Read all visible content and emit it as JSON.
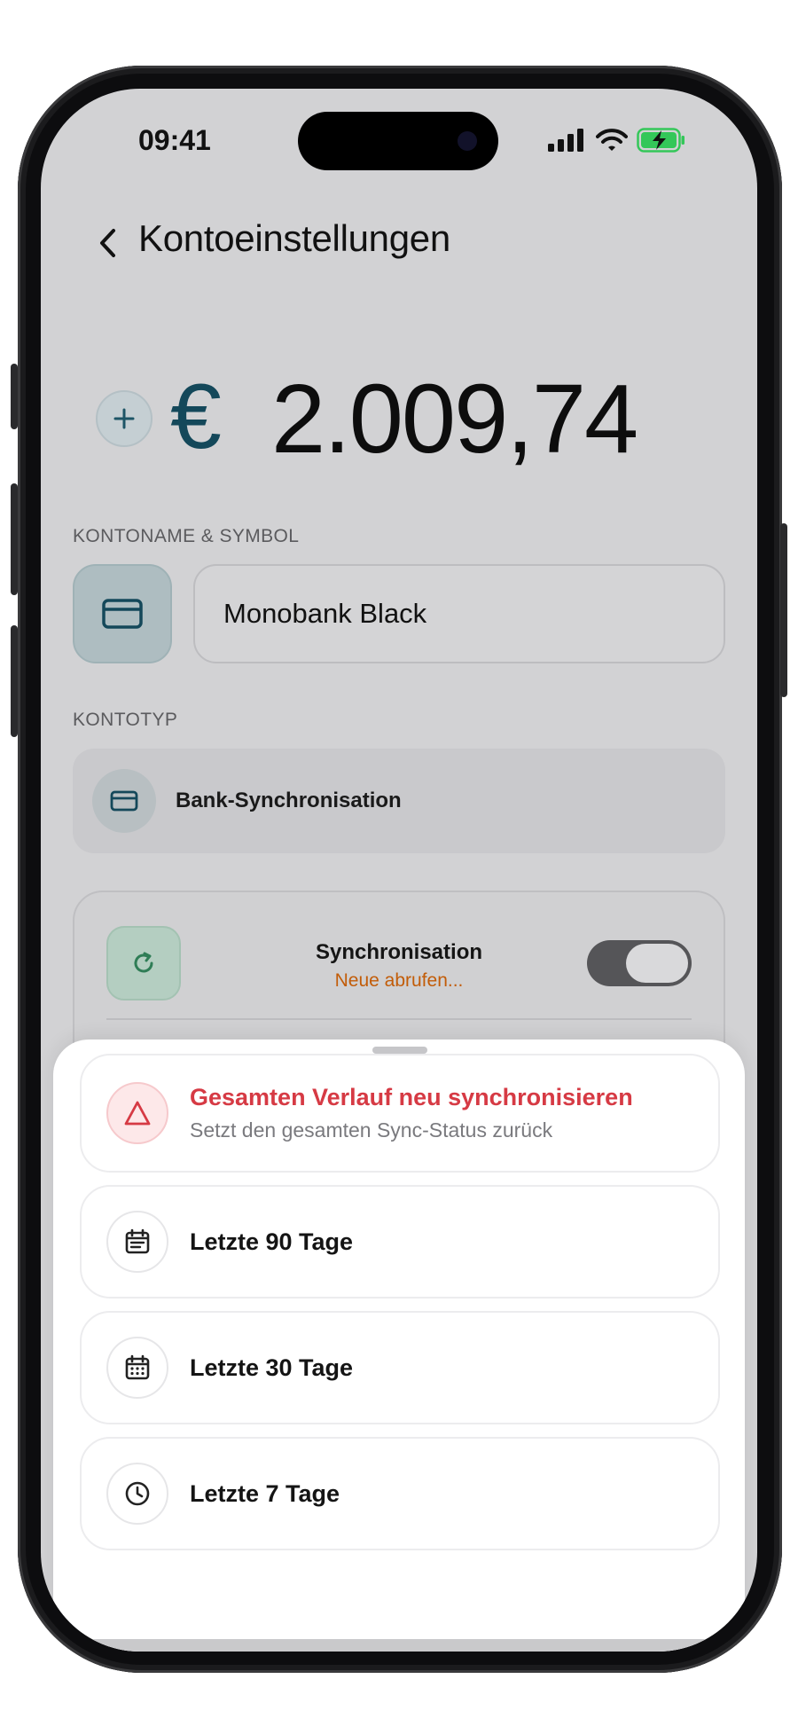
{
  "status_bar": {
    "time": "09:41"
  },
  "header": {
    "back_icon": "chevron-left-icon",
    "title": "Kontoeinstellungen"
  },
  "balance": {
    "add_icon": "plus-icon",
    "currency_symbol": "€",
    "amount": "2.009,74"
  },
  "account_name": {
    "section_label": "KONTONAME & SYMBOL",
    "symbol_icon": "credit-card-icon",
    "value": "Monobank Black"
  },
  "account_type": {
    "section_label": "KONTOTYP",
    "icon": "credit-card-icon",
    "label": "Bank-Synchronisation"
  },
  "sync": {
    "icon": "refresh-icon",
    "title": "Synchronisation",
    "status": "Neue abrufen...",
    "toggle_on": true
  },
  "sheet": {
    "options": [
      {
        "icon": "warning-triangle-icon",
        "title": "Gesamten Verlauf neu synchronisieren",
        "subtitle": "Setzt den gesamten Sync-Status zurück",
        "danger": true
      },
      {
        "icon": "calendar-list-icon",
        "title": "Letzte 90 Tage"
      },
      {
        "icon": "calendar-grid-icon",
        "title": "Letzte 30 Tage"
      },
      {
        "icon": "clock-icon",
        "title": "Letzte 7 Tage"
      }
    ]
  },
  "colors": {
    "accent_teal": "#14485a",
    "danger_red": "#d63a44",
    "status_orange": "#c25c08",
    "battery_green": "#34c759"
  }
}
